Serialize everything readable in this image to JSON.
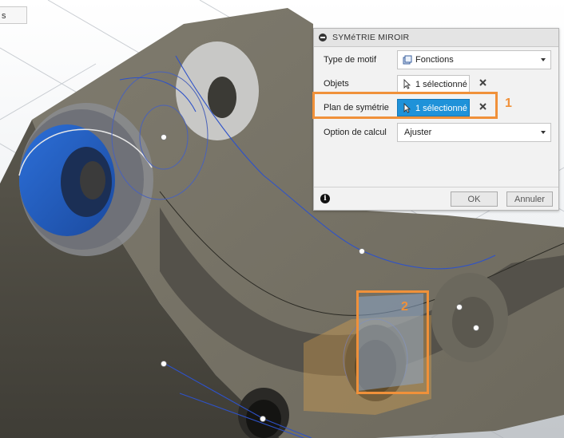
{
  "corner_tab": {
    "label": "s"
  },
  "dialog": {
    "title": "SYMéTRIE MIROIR",
    "rows": [
      {
        "label": "Type de motif",
        "value": "Fonctions",
        "icon": "feature-icon"
      },
      {
        "label": "Objets",
        "value": "1 sélectionné",
        "icon": "cursor-icon"
      },
      {
        "label": "Plan de symétrie",
        "value": "1 sélectionné",
        "icon": "cursor-icon"
      },
      {
        "label": "Option de calcul",
        "value": "Ajuster"
      }
    ],
    "ok_label": "OK",
    "cancel_label": "Annuler",
    "info_icon": "i"
  },
  "callouts": {
    "first": "1",
    "second": "2"
  },
  "colors": {
    "accent_blue": "#1f92d9",
    "highlight_orange": "#f0913a",
    "model_dark": "#5e5b50",
    "face_blue": "#2b60c4"
  }
}
